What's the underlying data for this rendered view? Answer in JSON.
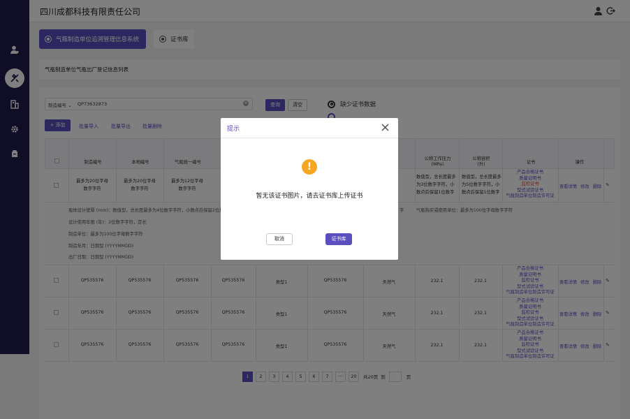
{
  "header": {
    "title": "四川成都科技有限责任公司"
  },
  "tabs": [
    {
      "label": "气瓶制造单位追溯管理信息系统"
    },
    {
      "label": "证书库"
    }
  ],
  "section_title": "气瓶制造单位气瓶出厂登记信息列表",
  "filter": {
    "field": "制造编号",
    "value": "QP73632873",
    "query_label": "查询",
    "clear_label": "清空",
    "missing_cert_label": "缺少证书数据"
  },
  "actions": {
    "add_label": "+ 添加",
    "import_label": "批量导入",
    "export_label": "批量导出",
    "delete_label": "批量删除"
  },
  "table": {
    "headers": [
      "制造编号",
      "本地编号",
      "气瓶统一编号",
      "公称工作压力\n(MPa)",
      "公称容积\n(升)",
      "证书",
      "操作"
    ],
    "first_row": {
      "col1": "最多为20位字母\n数字字符",
      "col2": "最多为20位字母\n数字字符",
      "col3": "最多为12位字母\n数字字符",
      "pressure": "数值型，总长度最多\n为3位数字字符，小\n数点后保留1位数字",
      "volume": "数值型，总长度最多\n为5位数字字符，小\n数点后保留1位数字"
    },
    "detail_lines": [
      "瓶体设计壁厚 (mm)：数值型，总长度最多为4位数字字符，小数点后保留2位数",
      "设计使用年限 (年)：2位数字字符，定长",
      "制造单位：最多为100位字母数字字符",
      "制造年月：日期型 (YYYYMMDD)",
      "出厂日期：日期型 (YYYYMMDD)"
    ],
    "detail_right": "气瓶购买或使用单位：最多为100位字母数字字符",
    "detail_mid": "字",
    "rows": [
      {
        "c1": "QP535576",
        "c2": "QP535576",
        "c3": "QP535576",
        "c4": "QP535576",
        "type": "类型1",
        "c6": "QP535576",
        "gas": "天然气",
        "pressure": "232.1",
        "volume": "232.1"
      },
      {
        "c1": "QP535576",
        "c2": "QP535576",
        "c3": "QP535576",
        "c4": "QP535576",
        "type": "类型1",
        "c6": "QP535576",
        "gas": "天然气",
        "pressure": "232.1",
        "volume": "232.1"
      },
      {
        "c1": "QP535576",
        "c2": "QP535576",
        "c3": "QP535576",
        "c4": "QP535576",
        "type": "类型1",
        "c6": "QP535576",
        "gas": "天然气",
        "pressure": "232.1",
        "volume": "232.1"
      }
    ],
    "certs": [
      "产品合格证书",
      "质量证明书",
      "监检证书",
      "型式试验证书",
      "气瓶制造单位制造许可证"
    ],
    "ops": [
      "查看详情",
      "修改",
      "删除"
    ]
  },
  "pager": {
    "pages": [
      "1",
      "2",
      "3",
      "4",
      "5",
      "6",
      "7",
      "···",
      "20"
    ],
    "total": "共20页",
    "goto": "到",
    "page_unit": "页"
  },
  "modal": {
    "title": "提示",
    "message": "暂无该证书图片，请去证书库上传证书",
    "cancel_label": "取消",
    "ok_label": "证书库"
  },
  "colors": {
    "accent": "#5b4fbf",
    "sidebar": "#201b4e",
    "warning": "#f5a623",
    "cert_red": "#e0473a"
  }
}
